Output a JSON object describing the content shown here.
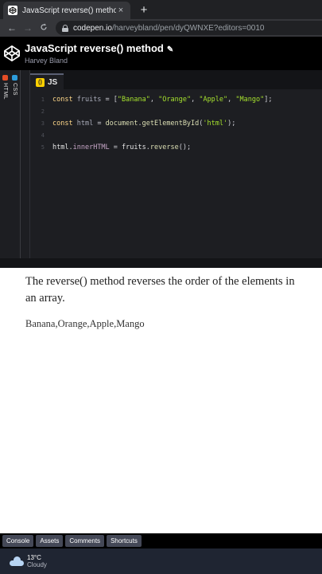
{
  "browser": {
    "tab_title": "JavaScript reverse() method",
    "tab_close": "×",
    "new_tab": "+",
    "url_host": "codepen.io",
    "url_path": "/harveybland/pen/dyQWNXE?editors=0010",
    "back": "←",
    "forward": "→",
    "reload": "C"
  },
  "codepen": {
    "title": "JavaScript reverse() method",
    "author": "Harvey Bland",
    "side_tabs": [
      {
        "label": "HTML",
        "color": "#e44d26"
      },
      {
        "label": "CSS",
        "color": "#2d9cdb"
      }
    ],
    "js_tab": {
      "badge": "()",
      "label": "JS",
      "color": "#fcd000"
    },
    "code_lines": [
      {
        "num": "1",
        "tokens": [
          {
            "t": "const ",
            "c": "kw"
          },
          {
            "t": "fruits",
            "c": "var"
          },
          {
            "t": " = [",
            "c": "op"
          },
          {
            "t": "\"Banana\"",
            "c": "str"
          },
          {
            "t": ", ",
            "c": "op"
          },
          {
            "t": "\"Orange\"",
            "c": "str"
          },
          {
            "t": ", ",
            "c": "op"
          },
          {
            "t": "\"Apple\"",
            "c": "str"
          },
          {
            "t": ", ",
            "c": "op"
          },
          {
            "t": "\"Mango\"",
            "c": "str"
          },
          {
            "t": "];",
            "c": "op"
          }
        ]
      },
      {
        "num": "2",
        "tokens": []
      },
      {
        "num": "3",
        "tokens": [
          {
            "t": "const ",
            "c": "kw"
          },
          {
            "t": "html",
            "c": "var"
          },
          {
            "t": " = ",
            "c": "op"
          },
          {
            "t": "document",
            "c": "fn"
          },
          {
            "t": ".",
            "c": "op"
          },
          {
            "t": "getElementById",
            "c": "fn"
          },
          {
            "t": "(",
            "c": "op"
          },
          {
            "t": "'html'",
            "c": "str"
          },
          {
            "t": ");",
            "c": "op"
          }
        ]
      },
      {
        "num": "4",
        "tokens": []
      },
      {
        "num": "5",
        "tokens": [
          {
            "t": "html",
            "c": "plain"
          },
          {
            "t": ".",
            "c": "op"
          },
          {
            "t": "innerHTML",
            "c": "prop"
          },
          {
            "t": " = ",
            "c": "op"
          },
          {
            "t": "fruits",
            "c": "plain"
          },
          {
            "t": ".",
            "c": "op"
          },
          {
            "t": "reverse",
            "c": "fn"
          },
          {
            "t": "();",
            "c": "op"
          }
        ]
      }
    ],
    "footer_buttons": [
      "Console",
      "Assets",
      "Comments",
      "Shortcuts"
    ]
  },
  "result": {
    "paragraph": "The reverse() method reverses the order of the elements in an array.",
    "output": "Banana,Orange,Apple,Mango"
  },
  "taskbar": {
    "temperature": "13°C",
    "condition": "Cloudy"
  }
}
